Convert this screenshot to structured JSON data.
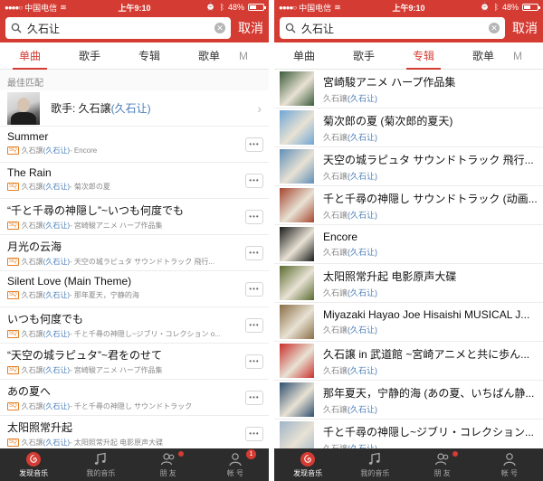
{
  "status": {
    "carrier": "中国电信",
    "time": "上午9:10",
    "battery": "48%",
    "battery_level": 0.48
  },
  "search": {
    "query": "久石让",
    "cancel_label": "取消"
  },
  "left": {
    "tabs": [
      {
        "label": "单曲",
        "active": true
      },
      {
        "label": "歌手",
        "active": false
      },
      {
        "label": "专辑",
        "active": false
      },
      {
        "label": "歌单",
        "active": false
      },
      {
        "label": "M",
        "active": false
      }
    ],
    "best_match_label": "最佳匹配",
    "best_match": {
      "prefix": "歌手: 久石譲",
      "alias": "(久石让)"
    },
    "songs": [
      {
        "title": "Summer",
        "artist": "久石譲",
        "alias": "(久石让)",
        "album": "- Encore"
      },
      {
        "title": "The Rain",
        "artist": "久石譲",
        "alias": "(久石让)",
        "album": "- 菊次郎の夏"
      },
      {
        "title": "“千と千尋の神隠し”~いつも何度でも",
        "artist": "久石譲",
        "alias": "(久石让)",
        "album": "- 宮崎駿アニメ ハープ作品集"
      },
      {
        "title": "月光の云海",
        "artist": "久石譲",
        "alias": "(久石让)",
        "album": "- 天空の城ラピュタ サウンドトラック 飛行..."
      },
      {
        "title": "Silent Love (Main Theme)",
        "artist": "久石譲",
        "alias": "(久石让)",
        "album": "- 那年夏天，宁静的海"
      },
      {
        "title": "いつも何度でも",
        "artist": "久石譲",
        "alias": "(久石让)",
        "album": "- 千と千尋の神隠し~ジブリ・コレクション o..."
      },
      {
        "title": "“天空の城ラピュタ”~君をのせて",
        "artist": "久石譲",
        "alias": "(久石让)",
        "album": "- 宮崎駿アニメ ハープ作品集"
      },
      {
        "title": "あの夏へ",
        "artist": "久石譲",
        "alias": "(久石让)",
        "album": "- 千と千尋の神隠し サウンドトラック"
      },
      {
        "title": "太阳照常升起",
        "artist": "久石譲",
        "alias": "(久石让)",
        "album": "- 太阳照常升起 电影原声大碟"
      }
    ],
    "nav": [
      {
        "label": "发现音乐",
        "active": true,
        "badge": ""
      },
      {
        "label": "我的音乐",
        "active": false,
        "badge": ""
      },
      {
        "label": "朋 友",
        "active": false,
        "badge": ""
      },
      {
        "label": "帐 号",
        "active": false,
        "badge": "1"
      }
    ]
  },
  "right": {
    "tabs": [
      {
        "label": "单曲",
        "active": false
      },
      {
        "label": "歌手",
        "active": false
      },
      {
        "label": "专辑",
        "active": true
      },
      {
        "label": "歌单",
        "active": false
      },
      {
        "label": "M",
        "active": false
      }
    ],
    "albums": [
      {
        "title": "宮崎駿アニメ ハープ作品集",
        "artist": "久石譲",
        "alias": "(久石让)",
        "cover": "#3b5b3a"
      },
      {
        "title": "菊次郎の夏 (菊次郎的夏天)",
        "artist": "久石譲",
        "alias": "(久石让)",
        "cover": "#6fa6d6"
      },
      {
        "title": "天空の城ラピュタ サウンドトラック 飛行...",
        "artist": "久石譲",
        "alias": "(久石让)",
        "cover": "#5f8fb8"
      },
      {
        "title": "千と千尋の神隠し サウンドトラック (动画...",
        "artist": "久石譲",
        "alias": "(久石让)",
        "cover": "#a6452f"
      },
      {
        "title": "Encore",
        "artist": "久石譲",
        "alias": "(久石让)",
        "cover": "#1a1a1a"
      },
      {
        "title": "太阳照常升起 电影原声大碟",
        "artist": "久石譲",
        "alias": "(久石让)",
        "cover": "#5a6b2f"
      },
      {
        "title": "Miyazaki Hayao Joe Hisaishi MUSICAL J...",
        "artist": "久石譲",
        "alias": "(久石让)",
        "cover": "#8b6d45"
      },
      {
        "title": "久石譲 in 武道館 ~宮崎アニメと共に歩ん...",
        "artist": "久石譲",
        "alias": "(久石让)",
        "cover": "#c9302c"
      },
      {
        "title": "那年夏天，宁静的海 (あの夏、いちばん静...",
        "artist": "久石譲",
        "alias": "(久石让)",
        "cover": "#2f4f6f"
      },
      {
        "title": "千と千尋の神隠し~ジブリ・コレクション...",
        "artist": "久石譲",
        "alias": "(久石让)",
        "cover": "#9fb4c8"
      }
    ],
    "nav": [
      {
        "label": "发现音乐",
        "active": true,
        "badge": ""
      },
      {
        "label": "我的音乐",
        "active": false,
        "badge": ""
      },
      {
        "label": "朋 友",
        "active": false,
        "badge": ""
      },
      {
        "label": "帐 号",
        "active": false,
        "badge": ""
      }
    ]
  },
  "colors": {
    "brand_red": "#d43c33",
    "alias_blue": "#4a7db7",
    "nav_bg": "#2c2c2c"
  }
}
